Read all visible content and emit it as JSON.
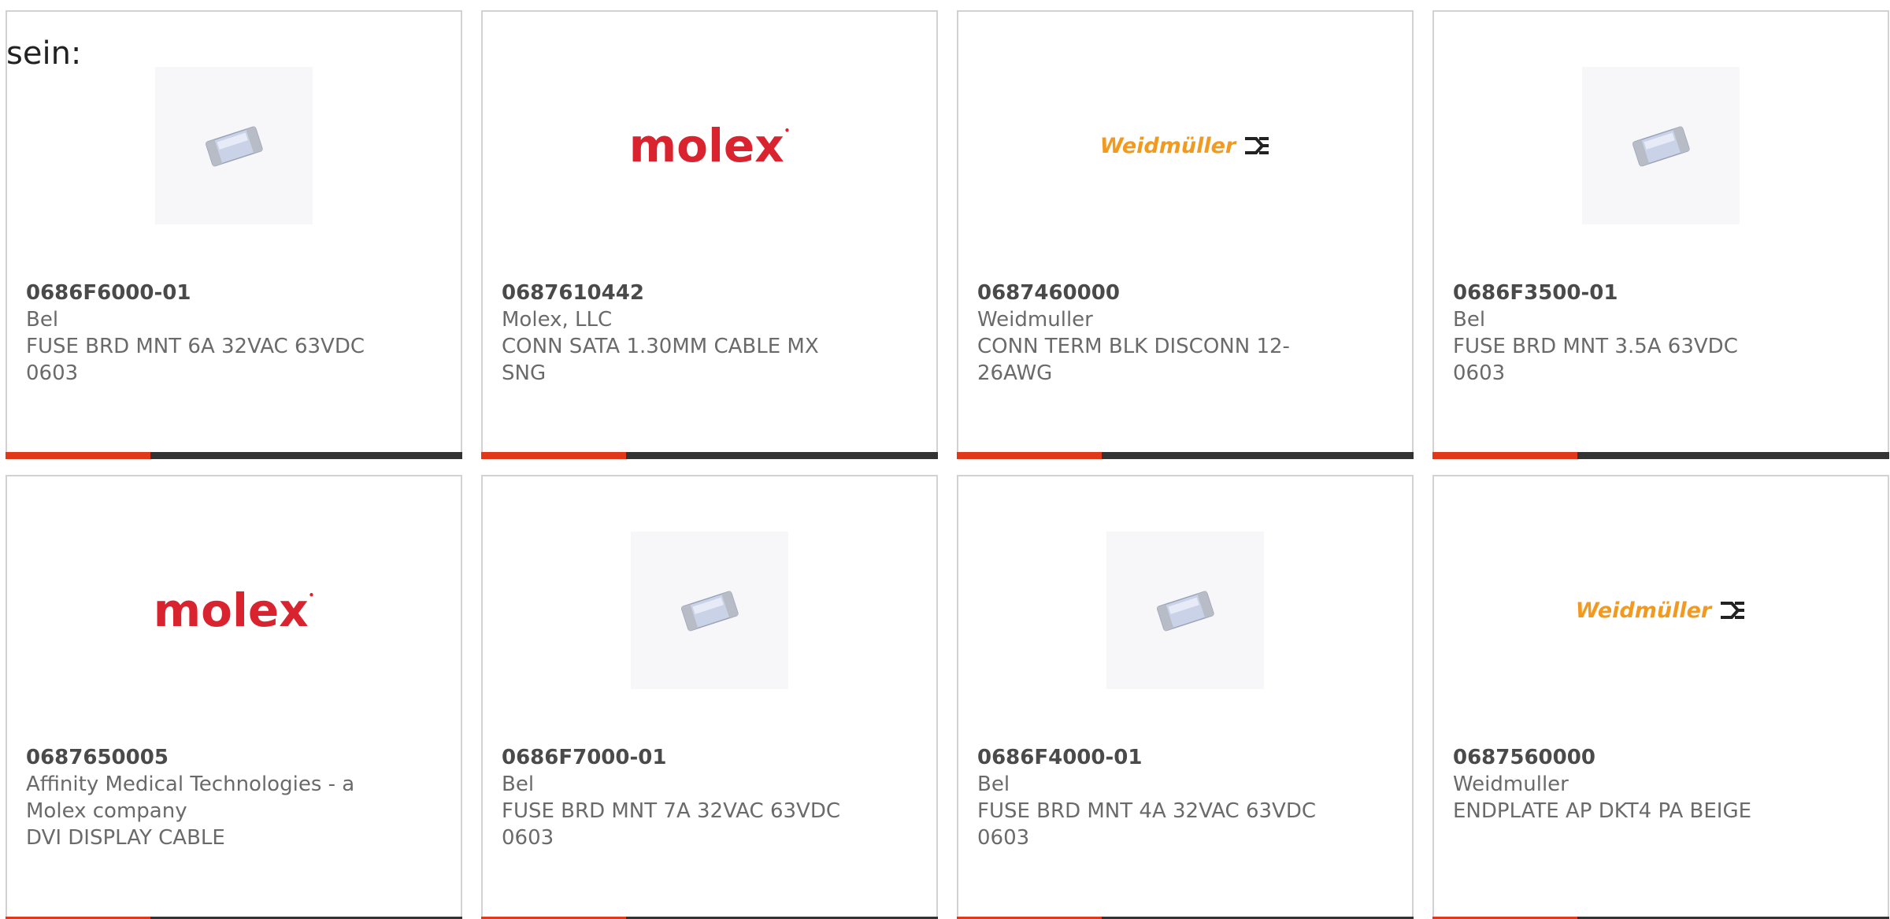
{
  "intro_text": "sein:",
  "accent_color": "#e0391a",
  "bar_color": "#333333",
  "products": [
    {
      "part_number": "0686F6000-01",
      "manufacturer": "Bel",
      "description": "FUSE BRD MNT 6A 32VAC 63VDC 0603",
      "image": "fuse-chip-icon"
    },
    {
      "part_number": "0687610442",
      "manufacturer": "Molex, LLC",
      "description": "CONN SATA 1.30MM CABLE MX SNG",
      "image": "molex-logo",
      "logo_text": "molex"
    },
    {
      "part_number": "0687460000",
      "manufacturer": "Weidmuller",
      "description": "CONN TERM BLK DISCONN 12-26AWG",
      "image": "weidmuller-logo",
      "logo_text": "Weidmüller"
    },
    {
      "part_number": "0686F3500-01",
      "manufacturer": "Bel",
      "description": "FUSE BRD MNT 3.5A 63VDC 0603",
      "image": "fuse-chip-icon"
    },
    {
      "part_number": "0687650005",
      "manufacturer": "Affinity Medical Technologies - a Molex company",
      "description": "DVI DISPLAY CABLE",
      "image": "molex-logo",
      "logo_text": "molex"
    },
    {
      "part_number": "0686F7000-01",
      "manufacturer": "Bel",
      "description": "FUSE BRD MNT 7A 32VAC 63VDC 0603",
      "image": "fuse-chip-icon"
    },
    {
      "part_number": "0686F4000-01",
      "manufacturer": "Bel",
      "description": "FUSE BRD MNT 4A 32VAC 63VDC 0603",
      "image": "fuse-chip-icon"
    },
    {
      "part_number": "0687560000",
      "manufacturer": "Weidmuller",
      "description": "ENDPLATE AP DKT4 PA BEIGE",
      "image": "weidmuller-logo",
      "logo_text": "Weidmüller"
    }
  ]
}
